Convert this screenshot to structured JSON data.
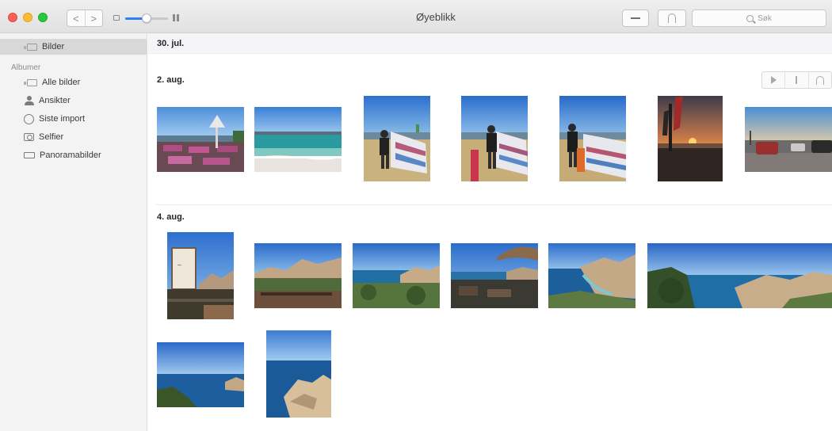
{
  "window": {
    "title": "Øyeblikk",
    "colors": {
      "close": "#fc5f57",
      "minimize": "#fdbc2e",
      "zoom": "#28c840",
      "accent": "#2f7ef6"
    }
  },
  "toolbar": {
    "back_icon": "chevron-left-icon",
    "forward_icon": "chevron-right-icon",
    "back_glyph": "<",
    "forward_glyph": ">",
    "zoom_level": 0.5,
    "search": {
      "placeholder": "Søk",
      "value": ""
    },
    "minus_icon": "minus-icon",
    "share_icon": "share-icon"
  },
  "sidebar": {
    "top_items": [
      {
        "label": "Bilder",
        "icon": "photos-icon",
        "selected": true
      }
    ],
    "albums_header": "Albumer",
    "albums": [
      {
        "label": "Alle bilder",
        "icon": "photos-icon"
      },
      {
        "label": "Ansikter",
        "icon": "person-icon"
      },
      {
        "label": "Siste import",
        "icon": "import-icon"
      },
      {
        "label": "Selfier",
        "icon": "selfie-icon"
      },
      {
        "label": "Panoramabilder",
        "icon": "pano-icon"
      }
    ]
  },
  "main": {
    "sticky_date": "30. jul.",
    "sections": [
      {
        "title": "2. aug.",
        "tools": [
          "play-icon",
          "info-icon",
          "share-icon"
        ],
        "photos": [
          {
            "subject": "restaurant-terrace-photo"
          },
          {
            "subject": "beach-sea-photo"
          },
          {
            "subject": "windsurfer-photo"
          },
          {
            "subject": "windsurfer-photo"
          },
          {
            "subject": "windsurfer-photo"
          },
          {
            "subject": "sunset-photo"
          },
          {
            "subject": "parking-lot-photo"
          }
        ]
      },
      {
        "title": "4. aug.",
        "photos": [
          {
            "subject": "signboard-photo"
          },
          {
            "subject": "rocky-coast-photo"
          },
          {
            "subject": "rocky-coast-photo"
          },
          {
            "subject": "terrace-umbrella-photo"
          },
          {
            "subject": "bay-photo"
          },
          {
            "subject": "panorama-coast-photo"
          },
          {
            "subject": "sea-coast-photo"
          },
          {
            "subject": "rocks-sea-photo"
          }
        ]
      }
    ]
  }
}
